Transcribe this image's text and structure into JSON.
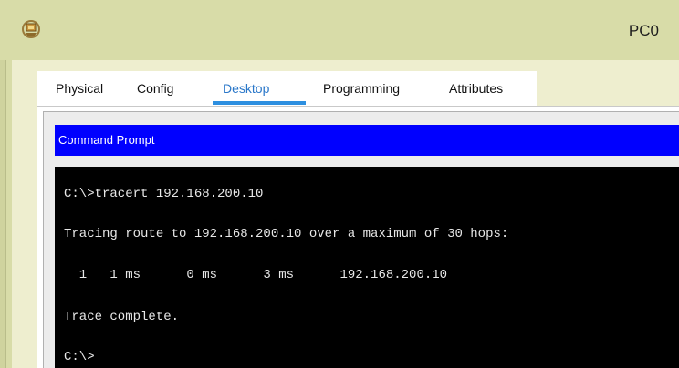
{
  "window": {
    "title": "PC0"
  },
  "tabs": [
    {
      "label": "Physical"
    },
    {
      "label": "Config"
    },
    {
      "label": "Desktop"
    },
    {
      "label": "Programming"
    },
    {
      "label": "Attributes"
    }
  ],
  "active_tab": "Desktop",
  "command_prompt": {
    "title": "Command Prompt",
    "lines": [
      "C:\\>tracert 192.168.200.10",
      "Tracing route to 192.168.200.10 over a maximum of 30 hops:",
      "  1   1 ms      0 ms      3 ms      192.168.200.10",
      "Trace complete.",
      "C:\\>"
    ]
  },
  "colors": {
    "window_bg": "#d8dca8",
    "panel_bg": "#eeeecf",
    "header_blue": "#0000ff",
    "tab_accent": "#2d8fe0",
    "terminal_bg": "#000000",
    "terminal_text": "#e8e8e8"
  },
  "icons": {
    "app_icon": "packet-tracer-pc-icon"
  }
}
